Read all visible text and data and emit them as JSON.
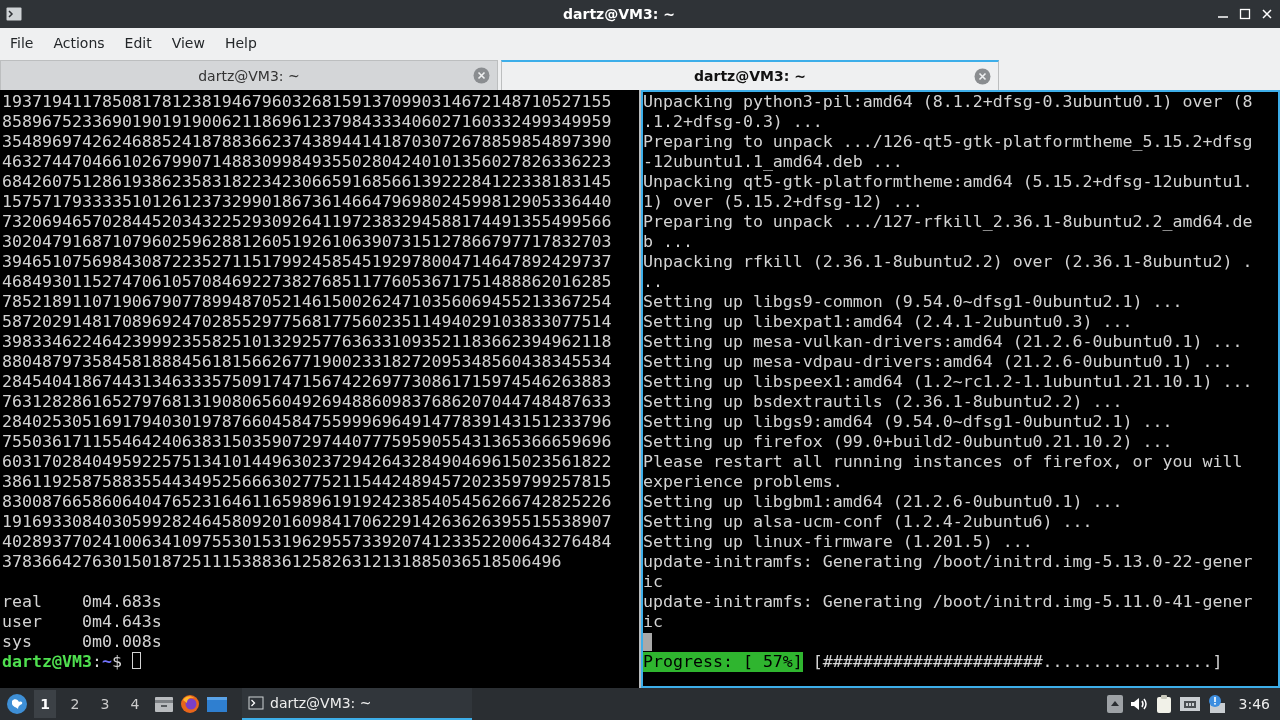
{
  "window": {
    "title": "dartz@VM3: ~"
  },
  "menu": [
    "File",
    "Actions",
    "Edit",
    "View",
    "Help"
  ],
  "tabs": [
    {
      "label": "dartz@VM3: ~",
      "selected": false
    },
    {
      "label": "dartz@VM3: ~",
      "selected": true
    }
  ],
  "left_pane": {
    "active": false,
    "lines": [
      "1937194117850817812381946796032681591370990314672148710527155",
      "8589675233690190191900621186961237984333406027160332499349959",
      "3548969742624688524187883662374389441418703072678859854897390",
      "4632744704661026799071488309984935502804240101356027826336223",
      "6842607512861938623583182234230665916856613922284122338183145",
      "1575717933335101261237329901867361466479698024599812905336440",
      "7320694657028445203432252930926411972383294588174491355499566",
      "3020479168710796025962881260519261063907315127866797717832703",
      "3946510756984308722352711517992458545192978004714647892429737",
      "4684930115274706105708469227382768511776053671751488862016285",
      "7852189110719067907789948705214615002624710356069455213367254",
      "5872029148170896924702855297756817756023511494029103833077514",
      "3983346224642399923558251013292577636331093521183662394962118",
      "8804879735845818884561815662677190023318272095348560438345534",
      "2845404186744313463335750917471567422697730861715974546263883",
      "7631282861652797681319080656049269488609837686207044748487633",
      "2840253051691794030197876604584755999696491477839143151233796",
      "7550361711554642406383150359072974407775959055431365366659696",
      "6031702840495922575134101449630237294264328490469615023561822",
      "3861192587588355443495256663027752115442489457202359799257815",
      "8300876658606404765231646116598961919242385405456266742825226",
      "1916933084030599282464580920160984170622914263626395515538907",
      "4028937702410063410975530153196295573392074123352200643276484",
      "37836642763015018725111538836125826312131885036518506496"
    ],
    "timing": [
      {
        "label": "real",
        "value": "0m4.683s"
      },
      {
        "label": "user",
        "value": "0m4.643s"
      },
      {
        "label": "sys",
        "value": "0m0.008s"
      }
    ],
    "prompt": {
      "user_host": "dartz@VM3",
      "separator": ":",
      "path": "~",
      "symbol": "$"
    }
  },
  "right_pane": {
    "active": true,
    "lines": [
      "Unpacking python3-pil:amd64 (8.1.2+dfsg-0.3ubuntu0.1) over (8",
      ".1.2+dfsg-0.3) ...",
      "Preparing to unpack .../126-qt5-gtk-platformtheme_5.15.2+dfsg",
      "-12ubuntu1.1_amd64.deb ...",
      "Unpacking qt5-gtk-platformtheme:amd64 (5.15.2+dfsg-12ubuntu1.",
      "1) over (5.15.2+dfsg-12) ...",
      "Preparing to unpack .../127-rfkill_2.36.1-8ubuntu2.2_amd64.de",
      "b ...",
      "Unpacking rfkill (2.36.1-8ubuntu2.2) over (2.36.1-8ubuntu2) .",
      "..",
      "Setting up libgs9-common (9.54.0~dfsg1-0ubuntu2.1) ...",
      "Setting up libexpat1:amd64 (2.4.1-2ubuntu0.3) ...",
      "Setting up mesa-vulkan-drivers:amd64 (21.2.6-0ubuntu0.1) ...",
      "Setting up mesa-vdpau-drivers:amd64 (21.2.6-0ubuntu0.1) ...",
      "Setting up libspeex1:amd64 (1.2~rc1.2-1.1ubuntu1.21.10.1) ...",
      "Setting up bsdextrautils (2.36.1-8ubuntu2.2) ...",
      "Setting up libgs9:amd64 (9.54.0~dfsg1-0ubuntu2.1) ...",
      "Setting up firefox (99.0+build2-0ubuntu0.21.10.2) ...",
      "Please restart all running instances of firefox, or you will",
      "experience problems.",
      "Setting up libgbm1:amd64 (21.2.6-0ubuntu0.1) ...",
      "Setting up alsa-ucm-conf (1.2.4-2ubuntu6) ...",
      "Setting up linux-firmware (1.201.5) ...",
      "update-initramfs: Generating /boot/initrd.img-5.13.0-22-gener",
      "ic",
      "update-initramfs: Generating /boot/initrd.img-5.11.0-41-gener",
      "ic"
    ],
    "progress": {
      "label": "Progress: [ 57%]",
      "bar": "[######################.................]"
    }
  },
  "taskbar": {
    "workspaces": [
      {
        "label": "1",
        "selected": true
      },
      {
        "label": "2",
        "selected": false
      },
      {
        "label": "3",
        "selected": false
      },
      {
        "label": "4",
        "selected": false
      }
    ],
    "tasks": [
      {
        "label": "dartz@VM3: ~",
        "selected": true
      }
    ],
    "clock": "3:46"
  }
}
